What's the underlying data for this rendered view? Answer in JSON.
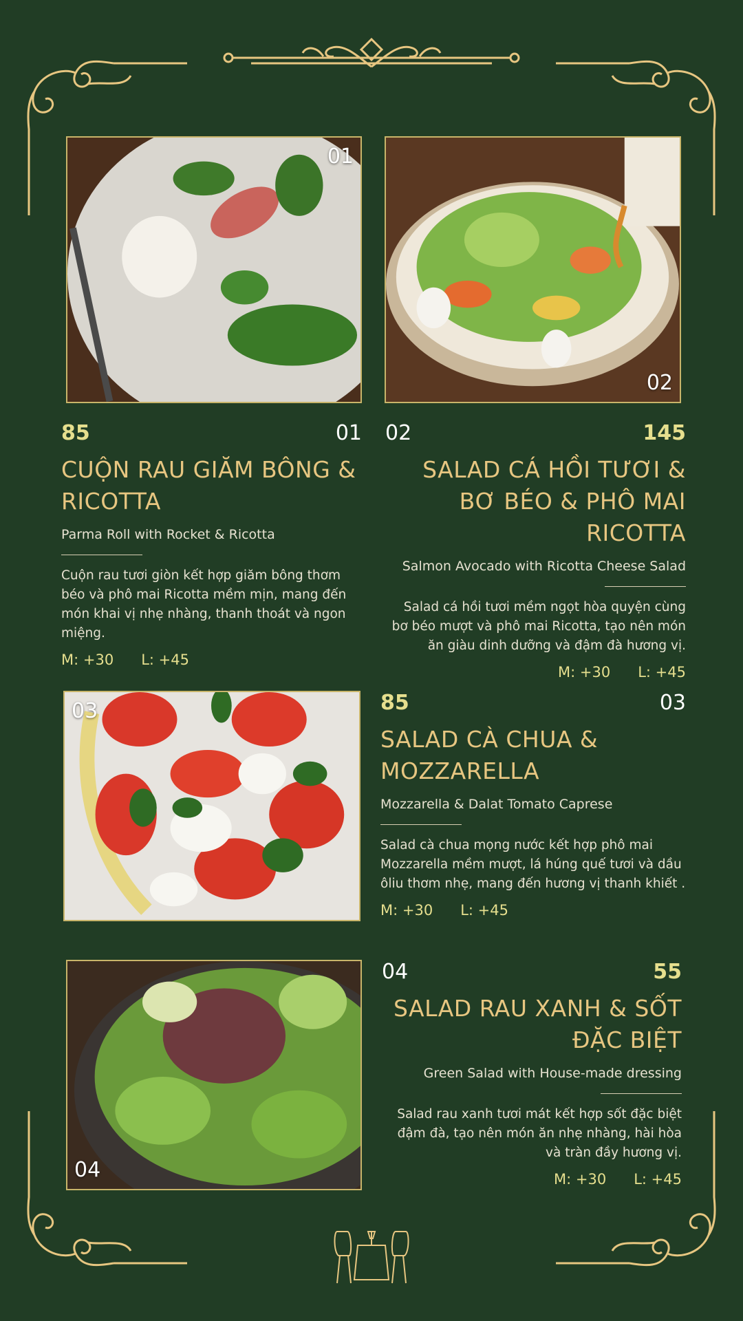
{
  "colors": {
    "background": "#213d25",
    "gold": "#e7c681",
    "price": "#e6df8e",
    "frame": "#c9b56a"
  },
  "items": [
    {
      "number": "01",
      "price": "85",
      "name": "CUỘN RAU GIĂM BÔNG & RICOTTA",
      "subtitle": "Parma Roll with Rocket & Ricotta",
      "description": "Cuộn rau tươi giòn kết hợp giăm bông thơm béo và phô mai Ricotta mềm mịn, mang đến món khai vị nhẹ nhàng, thanh thoát và ngon miệng.",
      "size_m": "M: +30",
      "size_l": "L: +45"
    },
    {
      "number": "02",
      "price": "145",
      "name": "SALAD CÁ HỒI TƯƠI & BƠ BÉO & PHÔ MAI RICOTTA",
      "subtitle": "Salmon Avocado with Ricotta Cheese Salad",
      "description": "Salad cá hồi tươi mềm ngọt hòa quyện cùng bơ béo mượt và phô mai Ricotta, tạo nên món ăn giàu dinh dưỡng và đậm đà hương vị.",
      "size_m": "M: +30",
      "size_l": "L: +45"
    },
    {
      "number": "03",
      "price": "85",
      "name": "SALAD CÀ CHUA & MOZZARELLA",
      "subtitle": "Mozzarella & Dalat Tomato Caprese",
      "description": "Salad cà chua mọng nước kết hợp phô mai Mozzarella mềm mượt, lá húng quế tươi và dầu ôliu thơm nhẹ, mang đến hương vị thanh khiết .",
      "size_m": "M: +30",
      "size_l": "L: +45"
    },
    {
      "number": "04",
      "price": "55",
      "name": "SALAD RAU XANH & SỐT ĐẶC BIỆT",
      "subtitle": "Green Salad with House-made dressing",
      "description": "Salad rau xanh tươi mát kết hợp sốt đặc biệt đậm đà, tạo nên món ăn nhẹ nhàng, hài hòa và tràn đầy hương vị.",
      "size_m": "M: +30",
      "size_l": "L: +45"
    }
  ]
}
